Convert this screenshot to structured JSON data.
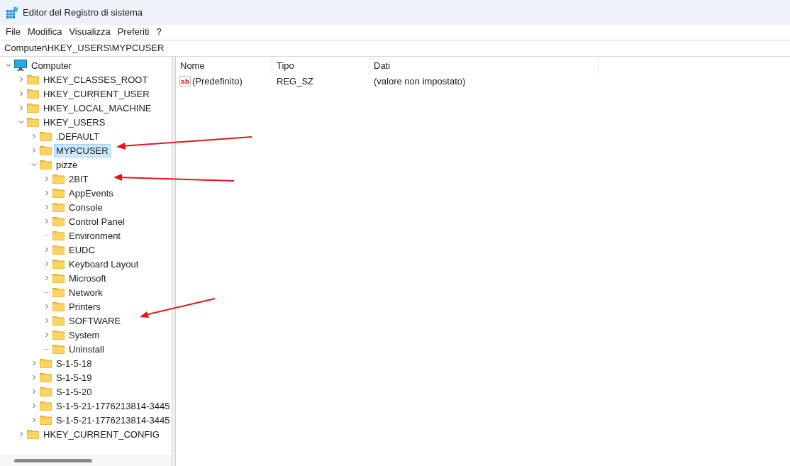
{
  "window": {
    "title": "Editor del Registro di sistema"
  },
  "menu": [
    "File",
    "Modifica",
    "Visualizza",
    "Preferiti",
    "?"
  ],
  "address": "Computer\\HKEY_USERS\\MYPCUSER",
  "tree": [
    {
      "label": "Computer",
      "kind": "computer",
      "expanded": true,
      "selected": false,
      "children": [
        {
          "label": "HKEY_CLASSES_ROOT",
          "kind": "branch",
          "expanded": false,
          "selected": false
        },
        {
          "label": "HKEY_CURRENT_USER",
          "kind": "branch",
          "expanded": false,
          "selected": false
        },
        {
          "label": "HKEY_LOCAL_MACHINE",
          "kind": "branch",
          "expanded": false,
          "selected": false
        },
        {
          "label": "HKEY_USERS",
          "kind": "branch",
          "expanded": true,
          "selected": false,
          "children": [
            {
              "label": ".DEFAULT",
              "kind": "branch",
              "expanded": false,
              "selected": false
            },
            {
              "label": "MYPCUSER",
              "kind": "branch",
              "expanded": false,
              "selected": true
            },
            {
              "label": "pizze",
              "kind": "branch",
              "expanded": true,
              "selected": false,
              "children": [
                {
                  "label": "2BIT",
                  "kind": "branch",
                  "expanded": false,
                  "selected": false
                },
                {
                  "label": "AppEvents",
                  "kind": "branch",
                  "expanded": false,
                  "selected": false
                },
                {
                  "label": "Console",
                  "kind": "branch",
                  "expanded": false,
                  "selected": false
                },
                {
                  "label": "Control Panel",
                  "kind": "branch",
                  "expanded": false,
                  "selected": false
                },
                {
                  "label": "Environment",
                  "kind": "leaf",
                  "selected": false
                },
                {
                  "label": "EUDC",
                  "kind": "branch",
                  "expanded": false,
                  "selected": false
                },
                {
                  "label": "Keyboard Layout",
                  "kind": "branch",
                  "expanded": false,
                  "selected": false
                },
                {
                  "label": "Microsoft",
                  "kind": "branch",
                  "expanded": false,
                  "selected": false
                },
                {
                  "label": "Network",
                  "kind": "leaf",
                  "selected": false
                },
                {
                  "label": "Printers",
                  "kind": "branch",
                  "expanded": false,
                  "selected": false
                },
                {
                  "label": "SOFTWARE",
                  "kind": "branch",
                  "expanded": false,
                  "selected": false
                },
                {
                  "label": "System",
                  "kind": "branch",
                  "expanded": false,
                  "selected": false
                },
                {
                  "label": "Uninstall",
                  "kind": "leaf",
                  "selected": false
                }
              ]
            },
            {
              "label": "S-1-5-18",
              "kind": "branch",
              "expanded": false,
              "selected": false
            },
            {
              "label": "S-1-5-19",
              "kind": "branch",
              "expanded": false,
              "selected": false
            },
            {
              "label": "S-1-5-20",
              "kind": "branch",
              "expanded": false,
              "selected": false
            },
            {
              "label": "S-1-5-21-1776213814-3445",
              "kind": "branch",
              "expanded": false,
              "selected": false
            },
            {
              "label": "S-1-5-21-1776213814-3445",
              "kind": "branch",
              "expanded": false,
              "selected": false
            }
          ]
        },
        {
          "label": "HKEY_CURRENT_CONFIG",
          "kind": "branch",
          "expanded": false,
          "selected": false
        }
      ]
    }
  ],
  "table": {
    "columns": [
      "Nome",
      "Tipo",
      "Dati"
    ],
    "rows": [
      {
        "icon": "ab",
        "name": "(Predefinito)",
        "type": "REG_SZ",
        "data": "(valore non impostato)"
      }
    ]
  }
}
